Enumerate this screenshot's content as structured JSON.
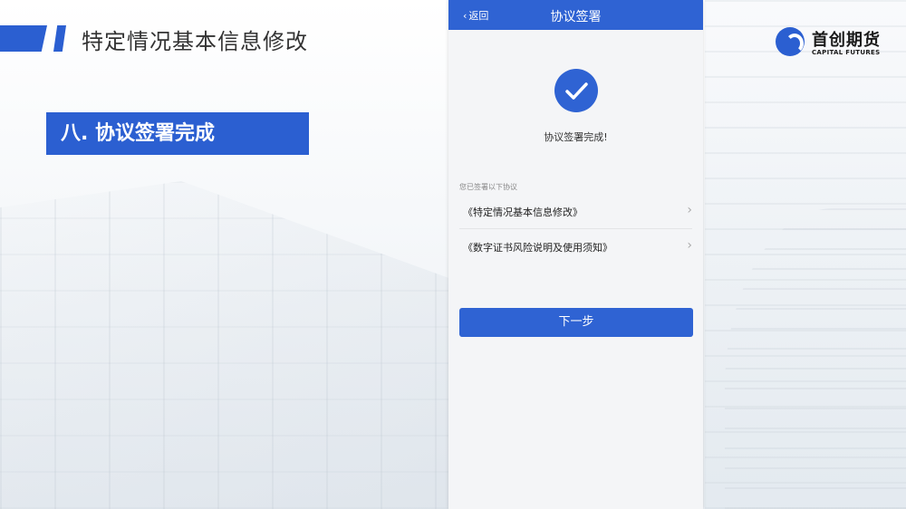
{
  "slide": {
    "title": "特定情况基本信息修改",
    "section": "八. 协议签署完成"
  },
  "logo": {
    "name_cn": "首创期货",
    "name_en": "CAPITAL FUTURES"
  },
  "phone": {
    "nav": {
      "back_label": "返回",
      "title": "协议签署"
    },
    "status_icon": "checkmark-icon",
    "success_message": "协议签署完成!",
    "signed_section_label": "您已签署以下协议",
    "agreements": [
      {
        "label": "《特定情况基本信息修改》"
      },
      {
        "label": "《数字证书风险说明及使用须知》"
      }
    ],
    "next_button": "下一步"
  },
  "colors": {
    "accent": "#2b5fd1",
    "phone_nav": "#2f63d3"
  }
}
